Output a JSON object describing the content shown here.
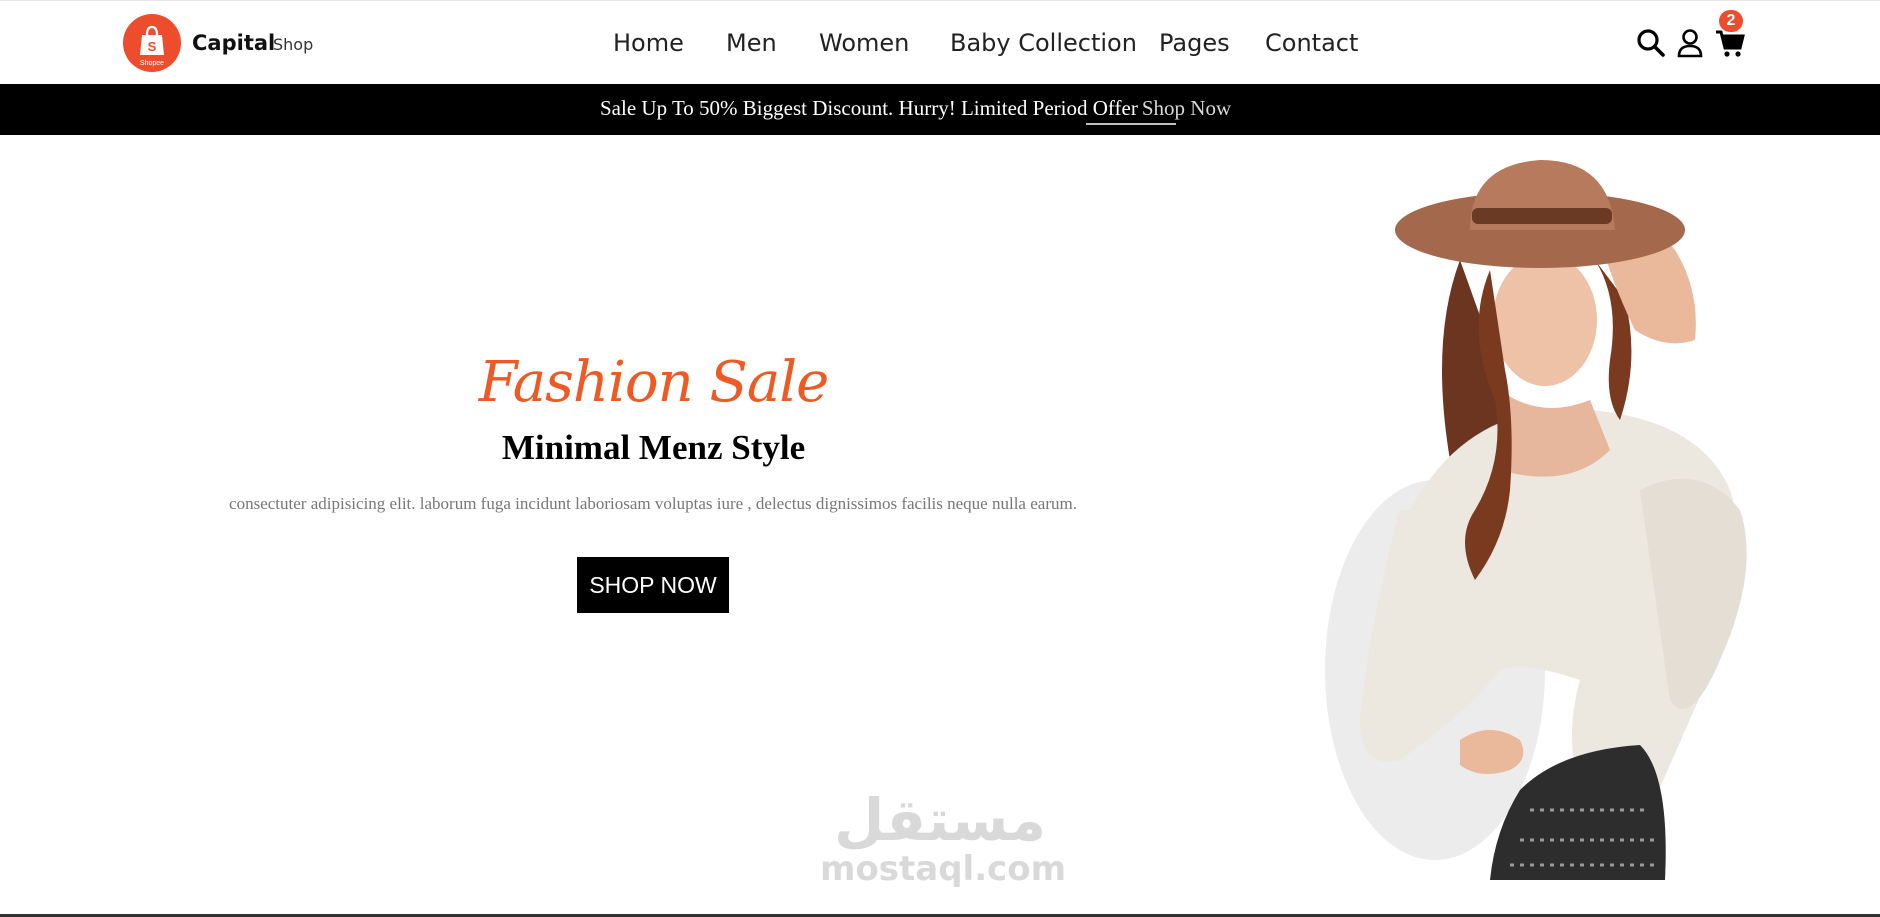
{
  "brand": {
    "name": "Capital",
    "sub": "Shop",
    "logo_text": "Shopee",
    "logo_icon": "shopping-bag-icon",
    "accent_color": "#ee4d2d"
  },
  "nav": {
    "items": [
      "Home",
      "Men",
      "Women",
      "Baby Collection",
      "Pages",
      "Contact"
    ]
  },
  "header_icons": {
    "search": "search-icon",
    "user": "user-icon",
    "cart": "cart-icon",
    "cart_count": "2"
  },
  "promo": {
    "text": "Sale Up To 50% Biggest Discount. Hurry! Limited Period Offer",
    "link": "Shop Now"
  },
  "hero": {
    "script_title": "Fashion Sale",
    "title": "Minimal Menz Style",
    "description": "consectuter adipisicing elit. laborum fuga incidunt laboriosam voluptas iure , delectus dignissimos facilis neque nulla earum.",
    "button": "SHOP NOW",
    "script_color": "#ee5a24"
  },
  "watermark": {
    "arabic": "مستقل",
    "latin": "mostaql.com"
  }
}
